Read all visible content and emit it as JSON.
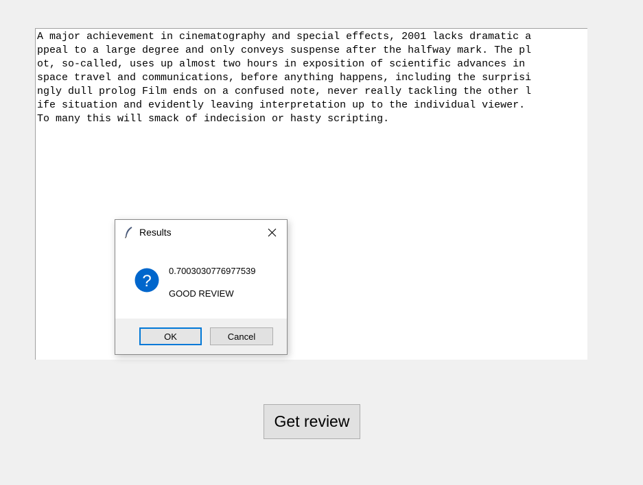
{
  "review_text": {
    "lines": [
      "A major achievement in cinematography and special effects, 2001 lacks dramatic a",
      "ppeal to a large degree and only conveys suspense after the halfway mark. The pl",
      "ot, so-called, uses up almost two hours in exposition of scientific advances in ",
      "space travel and communications, before anything happens, including the surprisi",
      "ngly dull prolog Film ends on a confused note, never really tackling the other l",
      "ife situation and evidently leaving interpretation up to the individual viewer.",
      "To many this will smack of indecision or hasty scripting."
    ]
  },
  "dialog": {
    "title": "Results",
    "title_icon": "feather-icon",
    "message_icon": "question-icon",
    "score": "0.7003030776977539",
    "verdict": "GOOD REVIEW",
    "ok_label": "OK",
    "cancel_label": "Cancel",
    "accent_color": "#0078d7"
  },
  "main": {
    "get_review_label": "Get review"
  }
}
